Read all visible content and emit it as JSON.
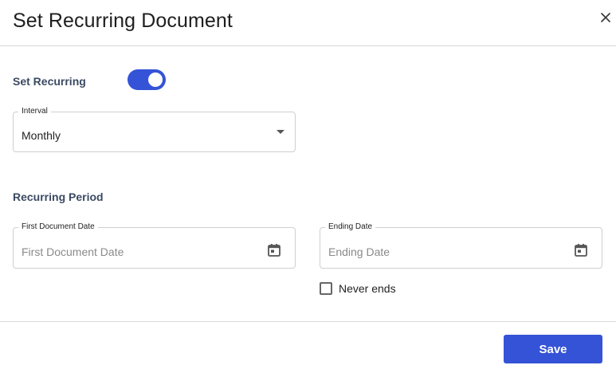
{
  "dialog": {
    "title": "Set Recurring Document",
    "close_icon": "close-icon"
  },
  "set_recurring": {
    "label": "Set Recurring",
    "enabled": true,
    "accent_color": "#3553d6"
  },
  "interval": {
    "label": "Interval",
    "value": "Monthly",
    "icon": "chevron-down-icon"
  },
  "recurring_period": {
    "label": "Recurring Period",
    "first_document_date": {
      "label": "First Document Date",
      "placeholder": "First Document Date",
      "icon": "calendar-icon"
    },
    "ending_date": {
      "label": "Ending Date",
      "placeholder": "Ending Date",
      "icon": "calendar-icon"
    },
    "never_ends": {
      "label": "Never ends",
      "checked": false
    }
  },
  "footer": {
    "save_label": "Save",
    "save_color": "#3553d6"
  }
}
